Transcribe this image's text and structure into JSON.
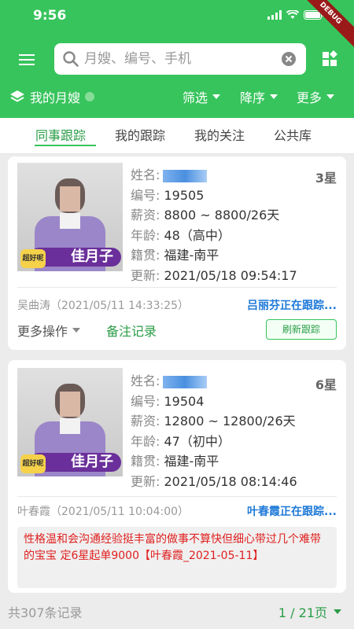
{
  "status_bar": {
    "time": "9:56",
    "debug_label": "DEBUG"
  },
  "search": {
    "placeholder": "月嫂、编号、手机",
    "value": ""
  },
  "subbar": {
    "title": "我的月嫂",
    "filter_label": "筛选",
    "sort_label": "降序",
    "more_label": "更多"
  },
  "tabs": [
    {
      "label": "同事跟踪",
      "active": true
    },
    {
      "label": "我的跟踪",
      "active": false
    },
    {
      "label": "我的关注",
      "active": false
    },
    {
      "label": "公共库",
      "active": false
    }
  ],
  "labels": {
    "name": "姓名:",
    "number": "编号:",
    "salary": "薪资:",
    "age": "年龄:",
    "origin": "籍贯:",
    "updated": "更新:",
    "logo_text": "佳月子",
    "logo_mini": "超好呢",
    "more_ops": "更多操作",
    "note_record": "备注记录",
    "refresh_tracking": "刷新跟踪"
  },
  "cards": [
    {
      "stars": "3星",
      "number": "19505",
      "salary": "8800 ~ 8800/26天",
      "age": "48（高中）",
      "origin": "福建-南平",
      "updated": "2021/05/18 09:54:17",
      "creator": "吴曲涛（2021/05/11 14:33:25）",
      "tracking": "吕丽芬正在跟踪..."
    },
    {
      "stars": "6星",
      "number": "19504",
      "salary": "12800 ~ 12800/26天",
      "age": "47（初中）",
      "origin": "福建-南平",
      "updated": "2021/05/18 08:14:46",
      "creator": "叶春霞（2021/05/11 10:04:00）",
      "tracking": "叶春霞正在跟踪...",
      "remark": "性格温和会沟通经验挺丰富的做事不算快但细心带过几个难带的宝宝 定6星起单9000【叶春霞_2021-05-11】"
    }
  ],
  "footer": {
    "total": "共307条记录",
    "page": "1 / 21页"
  },
  "colors": {
    "brand_green": "#37c45c",
    "link_blue": "#1f7ad8",
    "remark_red": "#e02020"
  }
}
